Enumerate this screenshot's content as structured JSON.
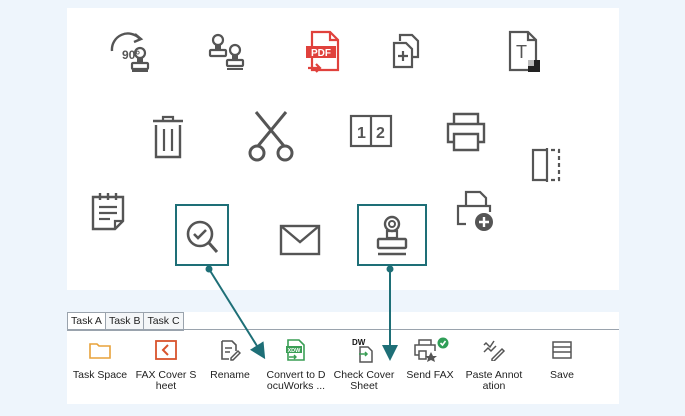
{
  "canvas": {
    "icons": [
      {
        "name": "rotate-90-stamp-icon",
        "label": "90°"
      },
      {
        "name": "stamp-pair-icon"
      },
      {
        "name": "pdf-export-icon",
        "label": "PDF"
      },
      {
        "name": "copy-pages-icon"
      },
      {
        "name": "text-annotation-icon",
        "label": "T"
      },
      {
        "name": "trash-icon"
      },
      {
        "name": "scissors-icon"
      },
      {
        "name": "page-number-icon",
        "label1": "1",
        "label2": "2"
      },
      {
        "name": "printer-icon"
      },
      {
        "name": "split-page-icon"
      },
      {
        "name": "notepad-icon"
      },
      {
        "name": "magnifier-check-icon"
      },
      {
        "name": "envelope-icon"
      },
      {
        "name": "stamp-icon"
      },
      {
        "name": "print-add-icon"
      }
    ]
  },
  "toolbar": {
    "tabs": [
      {
        "label": "Task A",
        "active": true
      },
      {
        "label": "Task B",
        "active": false
      },
      {
        "label": "Task C",
        "active": false
      }
    ],
    "items": [
      {
        "label": "Task Space",
        "icon": "folder-icon"
      },
      {
        "label": "FAX Cover S\nheet",
        "icon": "fax-cover-icon"
      },
      {
        "label": "Rename",
        "icon": "rename-icon"
      },
      {
        "label": "Convert to D\nocuWorks ...",
        "icon": "convert-docuworks-icon",
        "badge": "XDW"
      },
      {
        "label": "Check Cover\nSheet",
        "icon": "check-cover-sheet-icon",
        "badge": "DW"
      },
      {
        "label": "Send FAX",
        "icon": "send-fax-icon"
      },
      {
        "label": "Paste Annot\nation",
        "icon": "paste-annotation-icon"
      },
      {
        "label": "Save",
        "icon": "save-icon"
      }
    ]
  },
  "colors": {
    "accent": "#1e6f77",
    "pdf_red": "#e0413c",
    "toolbar_orange": "#e8a23a",
    "toolbar_red": "#d9532c",
    "toolbar_green": "#3a9e55",
    "check_green": "#2f9e57"
  }
}
